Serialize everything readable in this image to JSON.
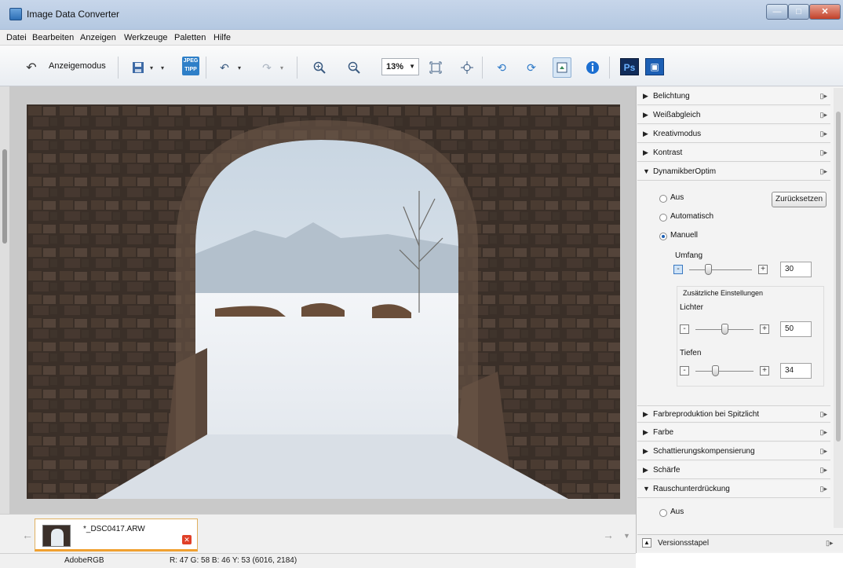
{
  "window": {
    "title": "Image Data Converter",
    "minimize": "—",
    "maximize": "□",
    "close": "✕"
  },
  "menu": [
    "Datei",
    "Bearbeiten",
    "Anzeigen",
    "Werkzeuge",
    "Paletten",
    "Hilfe"
  ],
  "toolbar": {
    "mode_label": "Anzeigemodus",
    "zoom_value": "13%",
    "jpeg_line1": "JPEG",
    "jpeg_line2": "TIPP",
    "ps_label": "Ps"
  },
  "filmstrip": {
    "file_name": "*_DSC0417.ARW"
  },
  "status": {
    "profile": "AdobeRGB",
    "pixel_info": "R: 47  G: 58  B: 46  Y: 53   (6016, 2184)"
  },
  "panel": {
    "sections_top": [
      "Belichtung",
      "Weißabgleich",
      "Kreativmodus",
      "Kontrast",
      "DynamikberOptim"
    ],
    "dro": {
      "options": [
        "Aus",
        "Automatisch",
        "Manuell"
      ],
      "selected": "Manuell",
      "reset_label": "Zurücksetzen",
      "range_label": "Umfang",
      "range_value": "30",
      "extra_label": "Zusätzliche Einstellungen",
      "highlights_label": "Lichter",
      "highlights_value": "50",
      "shadows_label": "Tiefen",
      "shadows_value": "34"
    },
    "sections_bottom": [
      "Farbreproduktion bei Spitzlicht",
      "Farbe",
      "Schattierungskompensierung",
      "Schärfe",
      "Rauschunterdrückung"
    ],
    "noise_option": "Aus",
    "version_stack": "Versionsstapel"
  },
  "colors": {
    "accent": "#1c5fb4",
    "title_bar": "#b4c8e1",
    "close_button": "#c2412a"
  },
  "slider_levels": {
    "umfang": 0.3,
    "lichter": 0.5,
    "tiefen": 0.34
  }
}
